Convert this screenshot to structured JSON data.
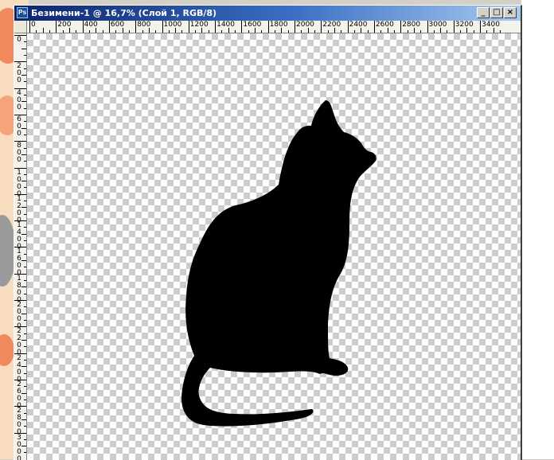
{
  "window": {
    "app_icon": "Ps",
    "title": "Безимени-1 @ 16,7% (Слой 1, RGB/8)",
    "controls": {
      "minimize": "_",
      "maximize": "□",
      "close": "×"
    }
  },
  "ruler": {
    "horizontal_labels": [
      "0",
      "200",
      "400",
      "600",
      "800",
      "1000",
      "1200",
      "1400",
      "1600",
      "1800",
      "2000",
      "2200",
      "2400",
      "2600",
      "2800",
      "3000",
      "3200",
      "3400"
    ],
    "vertical_labels": [
      "0",
      "2 0 0",
      "4 0 0",
      "6 0 0",
      "8 0 0",
      "1 0 0 0",
      "1 2 0 0",
      "1 4 0 0",
      "1 6 0 0",
      "1 8 0 0",
      "2 0 0 0",
      "2 2 0 0",
      "2 4 0 0",
      "2 6 0 0",
      "2 8 0 0",
      "3 0 0 0"
    ]
  },
  "canvas": {
    "zoom": "16,7%",
    "layer": "Слой 1",
    "color_mode": "RGB/8",
    "content": "cat-silhouette",
    "fill_color": "#000000",
    "transparency": true
  },
  "icons": [
    "photoshop-icon",
    "minimize-icon",
    "maximize-icon",
    "close-icon",
    "cat-silhouette"
  ]
}
